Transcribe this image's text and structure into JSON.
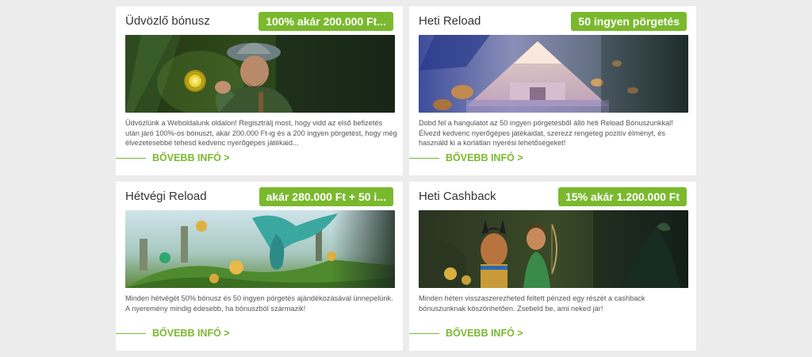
{
  "cards": [
    {
      "title": "Üdvözlő bónusz",
      "badge": "100% akár 200.000 Ft...",
      "description": "Üdvözlünk a Weboldalunk oldalon! Regisztrálj most, hogy vidd az első befizetés után járó 100%-os bónuszt, akár 200.000 Ft-ig és a 200 ingyen pörgetést, hogy még élvezetesebbé tehesd kedvenc nyerőgépes játékaid...",
      "more": "BŐVEBB INFÓ >"
    },
    {
      "title": "Heti Reload",
      "badge": "50 ingyen pörgetés",
      "description": "Dobd fel a hangulatot az 50 ingyen pörgetésből álló heti Reload Bónuszunkkal! Élvezd kedvenc nyerőgépes játékaidat, szerezz rengeteg pozitív élményt, és használd ki a korlátlan nyerési lehetőségeket!",
      "more": "BŐVEBB INFÓ >"
    },
    {
      "title": "Hétvégi Reload",
      "badge": "akár 280.000 Ft + 50 i...",
      "description": "Minden hétvégét 50% bónusz és 50 ingyen pörgetés ajándékozásával ünnepelünk. A nyeremény mindig édesebb, ha bónuszból származik!",
      "more": "BŐVEBB INFÓ >"
    },
    {
      "title": "Heti Cashback",
      "badge": "15% akár 1.200.000 Ft",
      "description": "Minden héten visszaszerezheted feltett pénzed egy részét a cashback bónuszunknak köszönhetően. Zsebeld be, ami neked jár!",
      "more": "BŐVEBB INFÓ >"
    }
  ],
  "colors": {
    "accent": "#7ab92e",
    "background": "#ececec",
    "card": "#ffffff"
  }
}
